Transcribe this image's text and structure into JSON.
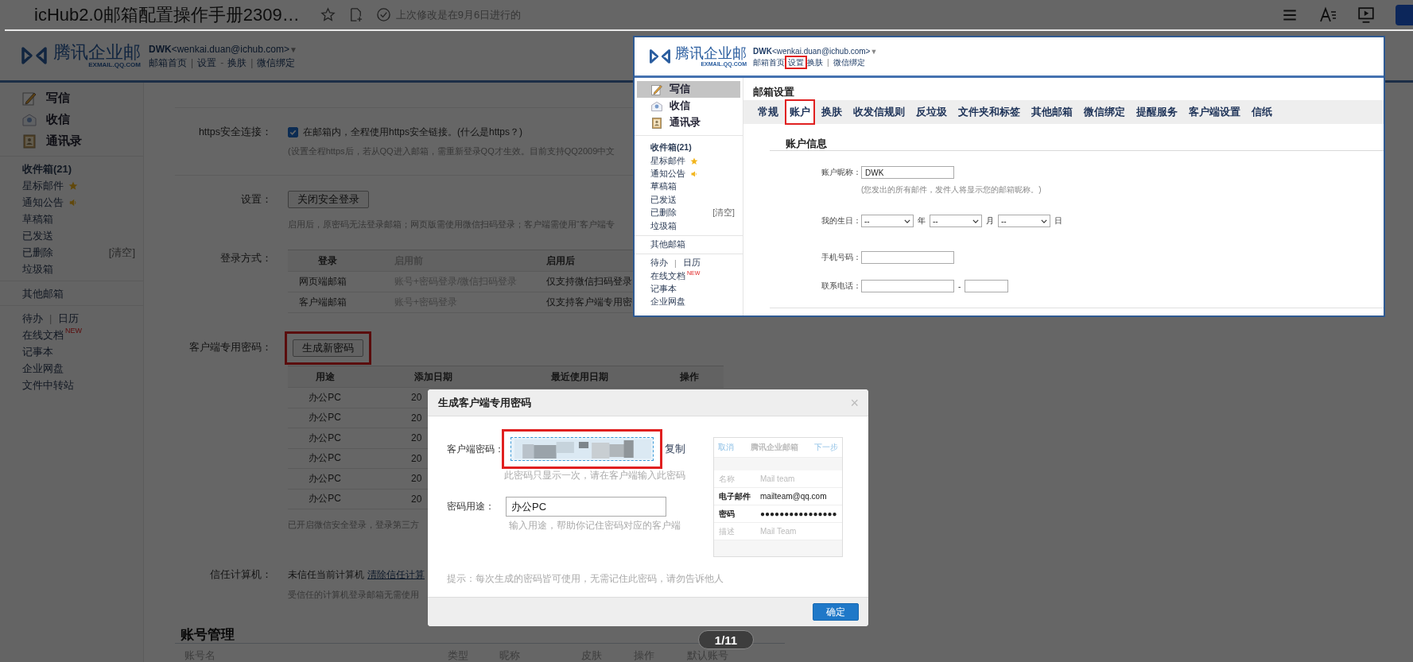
{
  "doc_viewer": {
    "title": "icHub2.0邮箱配置操作手册2309…",
    "status": "上次修改是在9月6日进行的",
    "page_counter": "1/11"
  },
  "mail_page": {
    "header": {
      "logo_text": "腾讯企业邮",
      "logo_domain": "EXMAIL.QQ.COM",
      "user_name": "DWK",
      "user_email": "<wenkai.duan@ichub.com>",
      "caret": "▼",
      "links": [
        {
          "kind": "link",
          "text": "邮箱首页",
          "highlighted": false
        },
        {
          "kind": "sep",
          "text": "|"
        },
        {
          "kind": "link",
          "text": "设置",
          "highlighted": false
        },
        {
          "kind": "sep",
          "text": "-"
        },
        {
          "kind": "link",
          "text": "换肤",
          "highlighted": false
        },
        {
          "kind": "sep",
          "text": "|"
        },
        {
          "kind": "link",
          "text": "微信绑定",
          "highlighted": false
        }
      ]
    },
    "sidebar": {
      "actions": [
        {
          "label": "写信",
          "selected": false
        },
        {
          "label": "收信",
          "selected": false
        },
        {
          "label": "通讯录",
          "selected": false
        }
      ],
      "groups": [
        [
          {
            "label": "收件箱(21)",
            "bold": true
          },
          {
            "label": "星标邮件",
            "kind": "starred",
            "bold": false
          },
          {
            "label": "通知公告",
            "kind": "notice",
            "bold": false
          },
          {
            "label": "草稿箱",
            "bold": false
          },
          {
            "label": "已发送",
            "bold": false
          },
          {
            "label": "已删除",
            "trailing": "[清空]",
            "bold": false
          },
          {
            "label": "垃圾箱",
            "bold": false
          }
        ],
        [
          {
            "label": "其他邮箱",
            "bold": false
          }
        ],
        [
          {
            "label": "待办",
            "separator": "|",
            "extra": "日历",
            "bold": false
          },
          {
            "label": "在线文档",
            "badge": "NEW",
            "bold": false
          },
          {
            "label": "记事本",
            "bold": false
          },
          {
            "label": "企业网盘",
            "bold": false
          },
          {
            "label": "文件中转站",
            "bold": false
          }
        ]
      ]
    },
    "settings": [
      {
        "kind": "checkbox",
        "label": "https安全连接：",
        "checked": true,
        "text": "在邮箱内，全程使用https安全链接。(什么是https？)",
        "hint": "(设置全程https后，若从QQ进入邮箱，需重新登录QQ才生效。目前支持QQ2009中文"
      },
      {
        "kind": "button",
        "label": "设置：",
        "button": "关闭安全登录",
        "hint": "启用后，原密码无法登录邮箱；网页版需使用微信扫码登录；客户端需使用“客户端专"
      },
      {
        "kind": "table",
        "label": "登录方式：",
        "columns": [
          "登录",
          "启用前",
          "启用后"
        ],
        "rows": [
          [
            "网页端邮箱",
            "账号+密码登录/微信扫码登录",
            "仅支持微信扫码登录"
          ],
          [
            "客户端邮箱",
            "账号+密码登录",
            "仅支持客户端专用密"
          ]
        ]
      },
      {
        "kind": "password_table",
        "label": "客户端专用密码：",
        "button": "生成新密码",
        "highlighted": true,
        "columns": [
          "用途",
          "添加日期",
          "最近使用日期",
          "操作"
        ],
        "rows": [
          [
            "办公PC",
            "20"
          ],
          [
            "办公PC",
            "20"
          ],
          [
            "办公PC",
            "20"
          ],
          [
            "办公PC",
            "20"
          ],
          [
            "办公PC",
            "20"
          ],
          [
            "办公PC",
            "20"
          ]
        ],
        "hint": "已开启微信安全登录，登录第三方"
      },
      {
        "kind": "link",
        "label": "信任计算机：",
        "text": "未信任当前计算机",
        "link": "清除信任计算",
        "hint": "受信任的计算机登录邮箱无需使用"
      }
    ],
    "account_section": {
      "title": "账号管理",
      "columns": [
        "账号名",
        "类型",
        "昵称",
        "皮肤",
        "操作",
        "默认账号"
      ]
    }
  },
  "dialog": {
    "title": "生成客户端专用密码",
    "close": "×",
    "fields": [
      {
        "kind": "secret",
        "label": "客户端密码：",
        "action": "复制",
        "hint": "此密码只显示一次，请在客户端输入此密码",
        "highlighted": true
      },
      {
        "kind": "input",
        "label": "密码用途：",
        "value": "办公PC",
        "hint": "输入用途，帮助你记住密码对应的客户端"
      }
    ],
    "tip": "提示：每次生成的密码皆可使用，无需记住此密码，请勿告诉他人",
    "confirm": "确定",
    "preview": {
      "cancel": "取消",
      "title": "腾讯企业邮箱",
      "next": "下一步",
      "rows": [
        {
          "label": "名称",
          "value": "Mail team",
          "emphasized": false
        },
        {
          "label": "电子邮件",
          "value": "mailteam@qq.com",
          "emphasized": true
        },
        {
          "label": "密码",
          "value": "●●●●●●●●●●●●●●●●",
          "emphasized": true
        },
        {
          "label": "描述",
          "value": "Mail Team",
          "emphasized": false
        }
      ]
    }
  },
  "inset": {
    "header": {
      "logo_text": "腾讯企业邮",
      "logo_domain": "EXMAIL.QQ.COM",
      "user_name": "DWK",
      "user_email": "<wenkai.duan@ichub.com>",
      "caret": "▼",
      "links": [
        {
          "kind": "link",
          "text": "邮箱首页",
          "highlighted": false
        },
        {
          "kind": "link",
          "text": "设置",
          "highlighted": true
        },
        {
          "kind": "link",
          "text": "换肤",
          "highlighted": false
        },
        {
          "kind": "sep",
          "text": "|"
        },
        {
          "kind": "link",
          "text": "微信绑定",
          "highlighted": false
        }
      ]
    },
    "sidebar": {
      "actions": [
        {
          "label": "写信",
          "selected": true
        },
        {
          "label": "收信",
          "selected": false
        },
        {
          "label": "通讯录",
          "selected": false
        }
      ],
      "groups": [
        [
          {
            "label": "收件箱(21)",
            "bold": true
          },
          {
            "label": "星标邮件",
            "kind": "starred",
            "bold": false
          },
          {
            "label": "通知公告",
            "kind": "notice",
            "bold": false
          },
          {
            "label": "草稿箱",
            "bold": false
          },
          {
            "label": "已发送",
            "bold": false
          },
          {
            "label": "已删除",
            "trailing": "[清空]",
            "bold": false
          },
          {
            "label": "垃圾箱",
            "bold": false
          }
        ],
        [
          {
            "label": "其他邮箱",
            "bold": false
          }
        ],
        [
          {
            "label": "待办",
            "separator": "|",
            "extra": "日历",
            "bold": false
          },
          {
            "label": "在线文档",
            "badge": "NEW",
            "bold": false
          },
          {
            "label": "记事本",
            "bold": false
          },
          {
            "label": "企业网盘",
            "bold": false
          }
        ]
      ]
    },
    "settings_title": "邮箱设置",
    "tabs": [
      {
        "label": "常规",
        "selected": false,
        "highlighted": false
      },
      {
        "label": "账户",
        "selected": true,
        "highlighted": true
      },
      {
        "label": "换肤",
        "selected": false,
        "highlighted": false
      },
      {
        "label": "收发信规则",
        "selected": false,
        "highlighted": false
      },
      {
        "label": "反垃圾",
        "selected": false,
        "highlighted": false
      },
      {
        "label": "文件夹和标签",
        "selected": false,
        "highlighted": false
      },
      {
        "label": "其他邮箱",
        "selected": false,
        "highlighted": false
      },
      {
        "label": "微信绑定",
        "selected": false,
        "highlighted": false
      },
      {
        "label": "提醒服务",
        "selected": false,
        "highlighted": false
      },
      {
        "label": "客户端设置",
        "selected": false,
        "highlighted": false
      },
      {
        "label": "信纸",
        "selected": false,
        "highlighted": false
      }
    ],
    "section_title": "账户信息",
    "fields": [
      {
        "kind": "text",
        "label": "账户昵称：",
        "value": "DWK",
        "hint": "(您发出的所有邮件，发件人将显示您的邮箱昵称。)"
      },
      {
        "kind": "date",
        "label": "我的生日：",
        "parts": [
          {
            "value": "--",
            "unit": "年"
          },
          {
            "value": "--",
            "unit": "月"
          },
          {
            "value": "--",
            "unit": "日"
          }
        ]
      },
      {
        "kind": "text",
        "label": "手机号码："
      },
      {
        "kind": "phone",
        "label": "联系电话：",
        "separator": "-"
      }
    ]
  }
}
